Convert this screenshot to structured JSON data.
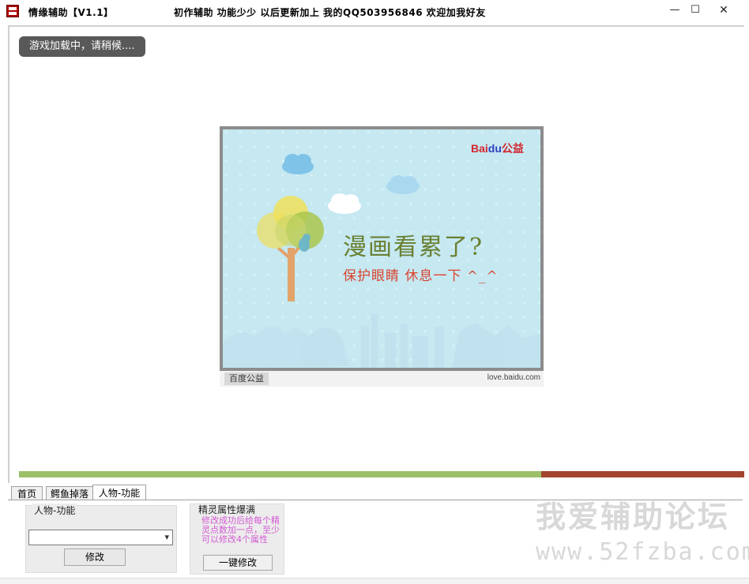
{
  "window": {
    "title": "情缘辅助【V1.1】",
    "message": "初作辅助 功能少少 以后更新加上 我的QQ503956846  欢迎加我好友",
    "minimize_glyph": "—",
    "maximize_glyph": "☐",
    "close_glyph": "✕"
  },
  "content": {
    "loading_text": "游戏加载中，请稍候...."
  },
  "ad": {
    "logo_bai": "Bai",
    "logo_du": "du",
    "logo_gongyi": "公益",
    "headline": "漫画看累了?",
    "tagline": "保护眼睛  休息一下  ^_^",
    "brand": "百度公益",
    "url": "love.baidu.com"
  },
  "progress": {
    "value": 0.72,
    "fill_color": "#9cc069",
    "track_color": "#a1452e"
  },
  "tabs": [
    {
      "label": "首页"
    },
    {
      "label": "鳄鱼掉落"
    },
    {
      "label": "人物-功能"
    }
  ],
  "panel": {
    "char_group_title": "人物-功能",
    "char_select_value": "",
    "modify_button": "修改",
    "sprite_group_title": "精灵属性爆满",
    "sprite_desc": "修改成功后给每个精灵点数加一点，至少可以修改4个属性",
    "onekey_button": "一键修改"
  },
  "watermark": {
    "line1": "我爱辅助论坛",
    "line2": "www.52fzba.com"
  }
}
